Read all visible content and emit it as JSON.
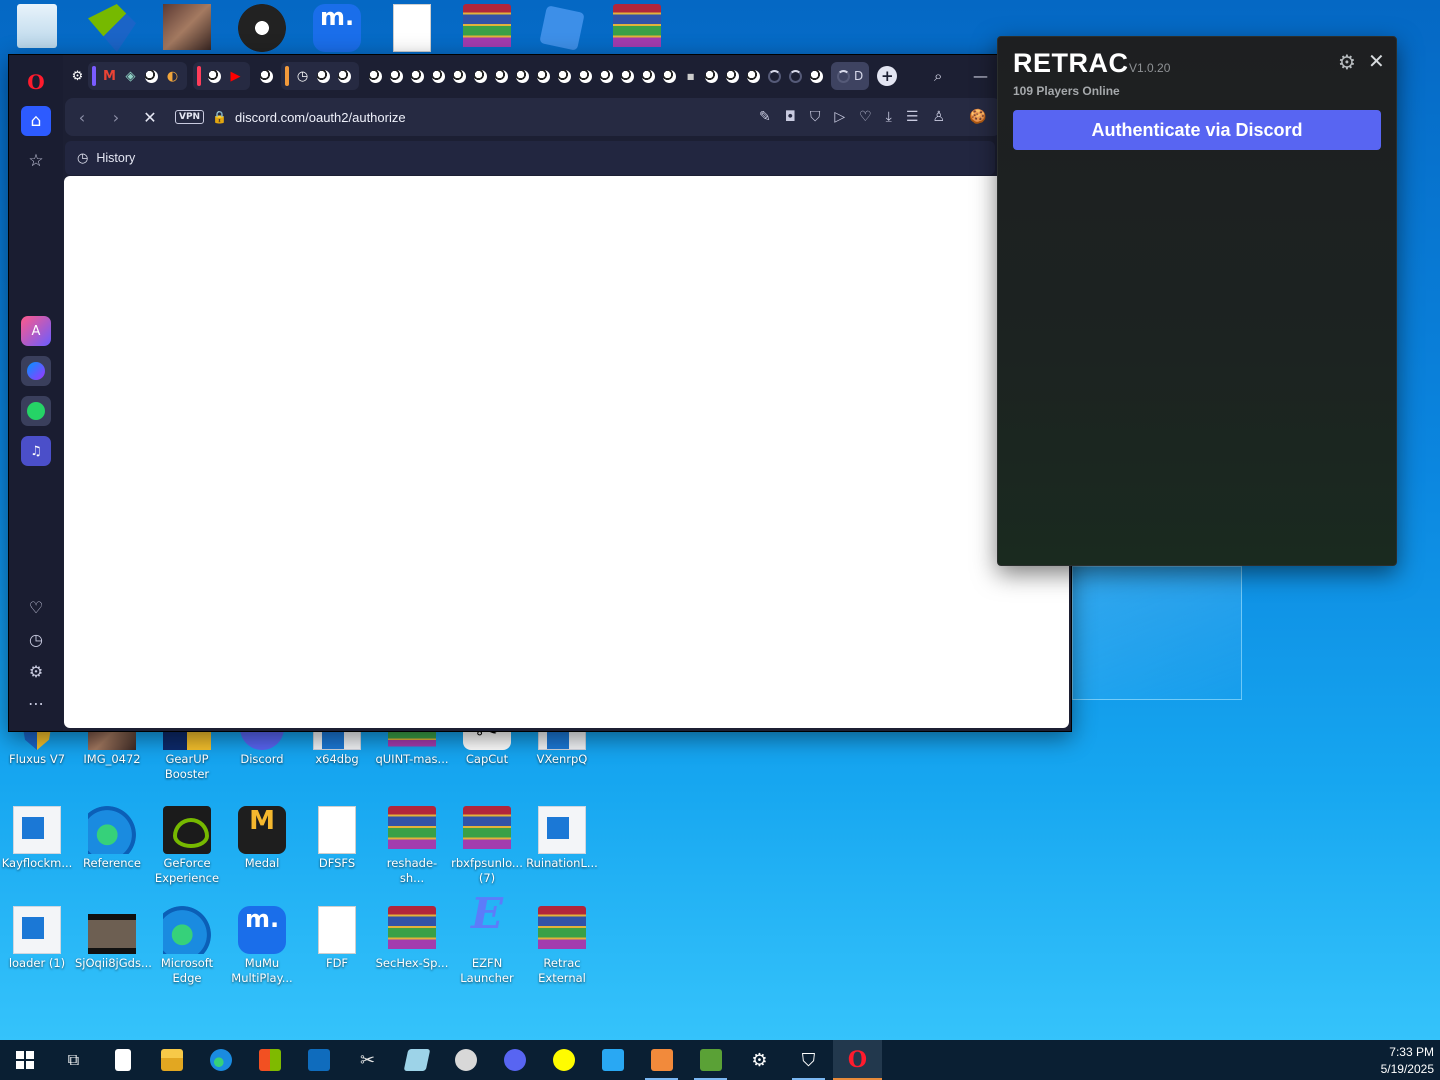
{
  "desktop": {
    "top_row": [
      "",
      "",
      "",
      "",
      "",
      "",
      "",
      ""
    ],
    "row1": [
      {
        "label": "Fluxus V7",
        "icon": "shield-app-icon"
      },
      {
        "label": "IMG_0472",
        "icon": "photo-icon"
      },
      {
        "label": "GearUP Booster",
        "icon": "gearup-icon"
      },
      {
        "label": "Discord",
        "icon": "discord-icon"
      },
      {
        "label": "x64dbg",
        "icon": "app-window-icon"
      },
      {
        "label": "qUINT-mas...",
        "icon": "winrar-archive-icon"
      },
      {
        "label": "CapCut",
        "icon": "capcut-icon"
      },
      {
        "label": "VXenrpQ",
        "icon": "app-window-icon"
      }
    ],
    "row2": [
      {
        "label": "Kayflockm...",
        "icon": "app-window-icon"
      },
      {
        "label": "Reference",
        "icon": "edge-icon"
      },
      {
        "label": "GeForce Experience",
        "icon": "nvidia-icon"
      },
      {
        "label": "Medal",
        "icon": "medal-icon"
      },
      {
        "label": "DFSFS",
        "icon": "blank-document-icon"
      },
      {
        "label": "reshade-sh...",
        "icon": "winrar-archive-icon"
      },
      {
        "label": "rbxfpsunlo... (7)",
        "icon": "winrar-archive-icon"
      },
      {
        "label": "RuinationL...",
        "icon": "app-window-icon"
      }
    ],
    "row3": [
      {
        "label": "loader (1)",
        "icon": "app-window-icon"
      },
      {
        "label": "SjOqii8jGds...",
        "icon": "video-icon"
      },
      {
        "label": "Microsoft Edge",
        "icon": "edge-icon"
      },
      {
        "label": "MuMu MultiPlay...",
        "icon": "mumu-icon"
      },
      {
        "label": "FDF",
        "icon": "blank-document-icon"
      },
      {
        "label": "SecHex-Sp...",
        "icon": "winrar-archive-icon"
      },
      {
        "label": "EZFN Launcher",
        "icon": "ezfn-icon"
      },
      {
        "label": "Retrac External",
        "icon": "winrar-archive-icon"
      }
    ]
  },
  "browser": {
    "url": "discord.com/oauth2/authorize",
    "vpn_label": "VPN",
    "bookmark_label": "History",
    "active_tab_label": "D",
    "stop_glyph": "✕"
  },
  "retrac": {
    "title": "RETRAC",
    "version": "V1.0.20",
    "players_online": "109 Players Online",
    "auth_button": "Authenticate via Discord",
    "accent_color": "#5865f2"
  },
  "taskbar": {
    "time": "7:33 PM",
    "date": "5/19/2025"
  }
}
